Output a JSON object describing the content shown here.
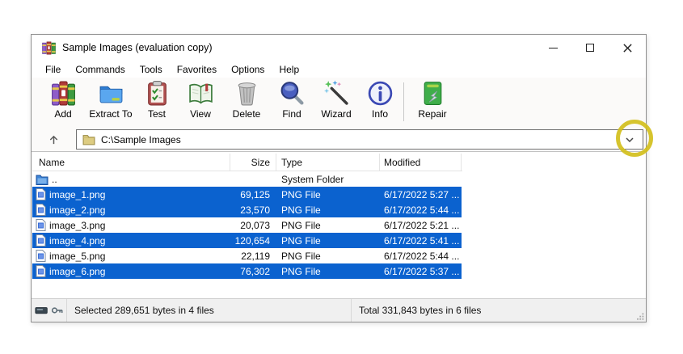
{
  "window": {
    "title": "Sample Images (evaluation copy)"
  },
  "menu": {
    "items": [
      "File",
      "Commands",
      "Tools",
      "Favorites",
      "Options",
      "Help"
    ]
  },
  "toolbar": {
    "buttons": [
      {
        "label": "Add"
      },
      {
        "label": "Extract To"
      },
      {
        "label": "Test"
      },
      {
        "label": "View"
      },
      {
        "label": "Delete"
      },
      {
        "label": "Find"
      },
      {
        "label": "Wizard"
      },
      {
        "label": "Info"
      },
      {
        "label": "Repair"
      }
    ]
  },
  "address_bar": {
    "path": "C:\\Sample Images"
  },
  "file_list": {
    "columns": [
      "Name",
      "Size",
      "Type",
      "Modified"
    ],
    "parent_row": {
      "name": "..",
      "size": "",
      "type": "System Folder",
      "modified": ""
    },
    "rows": [
      {
        "name": "image_1.png",
        "size": "69,125",
        "type": "PNG File",
        "modified": "6/17/2022 5:27 ...",
        "selected": true
      },
      {
        "name": "image_2.png",
        "size": "23,570",
        "type": "PNG File",
        "modified": "6/17/2022 5:44 ...",
        "selected": true
      },
      {
        "name": "image_3.png",
        "size": "20,073",
        "type": "PNG File",
        "modified": "6/17/2022 5:21 ...",
        "selected": false
      },
      {
        "name": "image_4.png",
        "size": "120,654",
        "type": "PNG File",
        "modified": "6/17/2022 5:41 ...",
        "selected": true
      },
      {
        "name": "image_5.png",
        "size": "22,119",
        "type": "PNG File",
        "modified": "6/17/2022 5:44 ...",
        "selected": false
      },
      {
        "name": "image_6.png",
        "size": "76,302",
        "type": "PNG File",
        "modified": "6/17/2022 5:37 ...",
        "selected": true
      }
    ]
  },
  "status_bar": {
    "selected_info": "Selected 289,651 bytes in 4 files",
    "total_info": "Total 331,843 bytes in 6 files"
  },
  "annotation": {
    "type": "circle-highlight-on-address-dropdown",
    "color": "#d2bf1c"
  },
  "colors": {
    "selection_blue": "#0b62cf",
    "chrome_bg": "#fbfaf9",
    "statusbar_bg": "#f0f0f0"
  }
}
